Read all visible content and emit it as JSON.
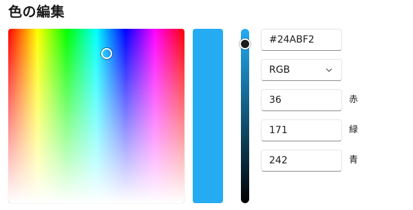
{
  "title": "色の編集",
  "color": {
    "hex_value": "#24ABF2",
    "preview_color": "#24ABF2",
    "value_level": 0.95,
    "spectrum_handle": {
      "hue_degrees": 201,
      "saturation": 0.85
    }
  },
  "mode_select": {
    "selected": "RGB"
  },
  "channels": [
    {
      "value": "36",
      "label": "赤"
    },
    {
      "value": "171",
      "label": "緑"
    },
    {
      "value": "242",
      "label": "青"
    }
  ],
  "colors": {
    "slider_top": "#24ABF2",
    "slider_bottom": "#000000"
  }
}
